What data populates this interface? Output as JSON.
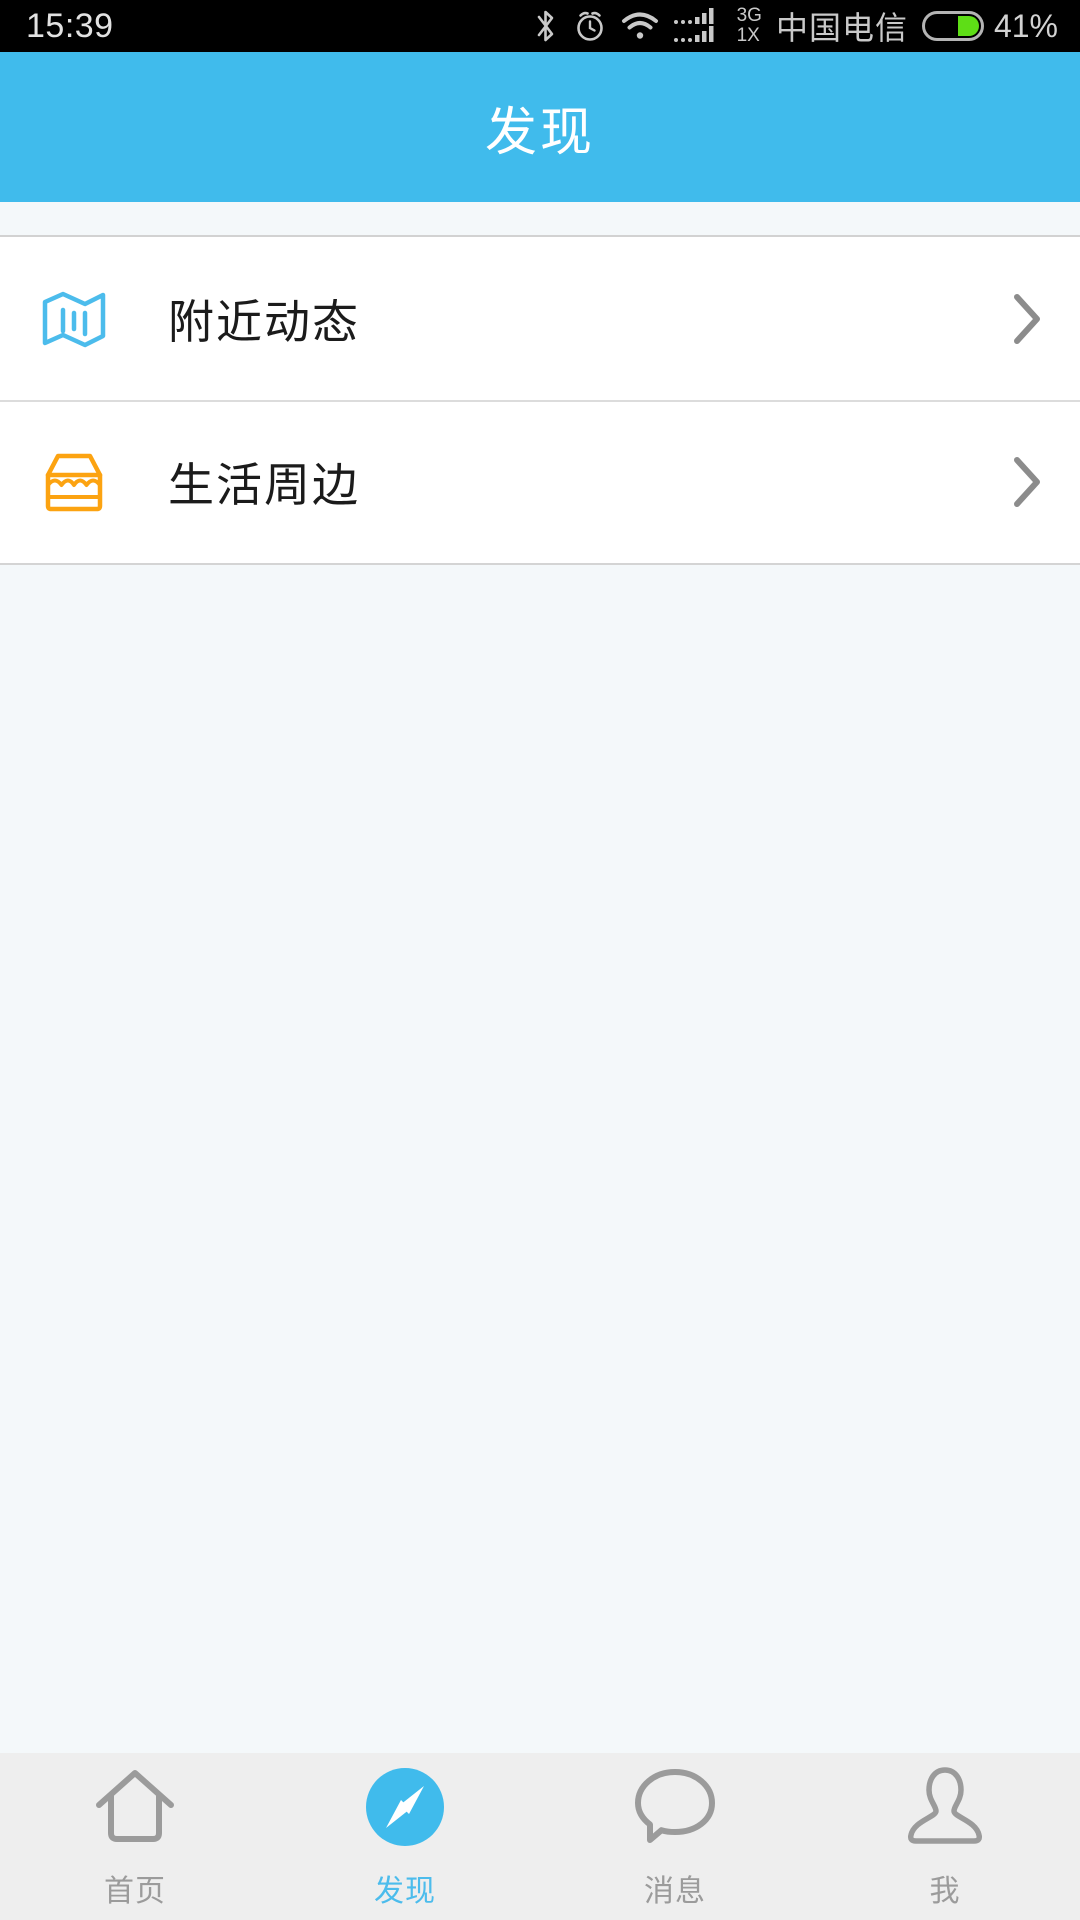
{
  "statusbar": {
    "time": "15:39",
    "bluetooth_icon": "bluetooth-icon",
    "alarm_icon": "alarm-icon",
    "wifi_icon": "wifi-icon",
    "signal_icon": "signal-bars-icon",
    "network_primary": "3G",
    "network_secondary": "1X",
    "carrier": "中国电信",
    "battery_icon": "battery-icon",
    "battery_percent": "41%",
    "battery_level": 41,
    "battery_color": "#5ede16"
  },
  "header": {
    "title": "发现",
    "background": "#40bbec",
    "text_color": "#ffffff"
  },
  "list": {
    "items": [
      {
        "icon": "map-icon",
        "icon_color": "#4cbcec",
        "label": "附近动态",
        "arrow": "chevron-right-icon"
      },
      {
        "icon": "storefront-icon",
        "icon_color": "#fca311",
        "label": "生活周边",
        "arrow": "chevron-right-icon"
      }
    ]
  },
  "tabbar": {
    "active_index": 1,
    "active_color": "#4cbcec",
    "inactive_color": "#9b9b9b",
    "items": [
      {
        "icon": "home-icon",
        "label": "首页"
      },
      {
        "icon": "compass-icon",
        "label": "发现"
      },
      {
        "icon": "message-icon",
        "label": "消息"
      },
      {
        "icon": "person-icon",
        "label": "我"
      }
    ]
  }
}
